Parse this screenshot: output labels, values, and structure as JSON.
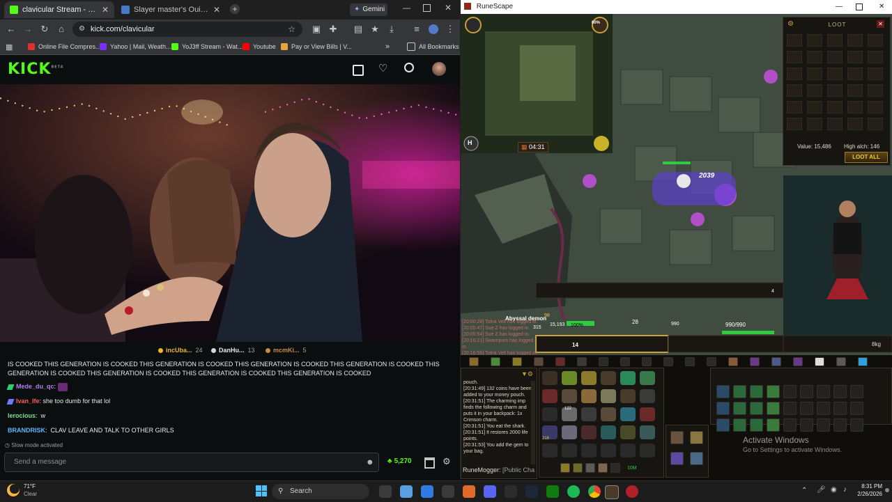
{
  "browser": {
    "tabs": [
      {
        "title": "clavicular Stream - Watch L",
        "active": true
      },
      {
        "title": "Slayer master's Ouija board - T",
        "active": false
      }
    ],
    "gemini_label": "Gemini",
    "url": "kick.com/clavicular",
    "bookmarks": [
      "Online File Compres...",
      "Yahoo | Mail, Weath...",
      "YoJ3ff Stream - Wat...",
      "Youtube",
      "Pay or View Bills | V...",
      "All Bookmarks"
    ],
    "bookmarks_more": "»"
  },
  "kick": {
    "logo_text": "KICK",
    "logo_badge": "BETA",
    "leaderboard": [
      {
        "name": "incUba...",
        "count": "24",
        "color": "#f0b429"
      },
      {
        "name": "DanHu...",
        "count": "13",
        "color": "#d9d9d9"
      },
      {
        "name": "mcmKi...",
        "count": "5",
        "color": "#c98a4b"
      }
    ],
    "chat": {
      "spam": "IS COOKED THIS GENERATION IS COOKED THIS GENERATION IS COOKED THIS GENERATION IS COOKED THIS GENERATION IS COOKED THIS GENERATION IS COOKED THIS GENERATION IS COOKED THIS GENERATION IS COOKED THIS GENERATION IS COOKED",
      "messages": [
        {
          "user": "Mede_du_qc",
          "text": "",
          "color": "#b37cf2",
          "badge": "#2ecc71"
        },
        {
          "user": "Ivan_Ife",
          "text": "she too dumb for that lol",
          "color": "#ff5a5a",
          "badge": "#6a7cff"
        },
        {
          "user": "lerocious",
          "text": "w",
          "color": "#7be08b",
          "badge": ""
        },
        {
          "user": "BRANDRISK",
          "text": "CLAV LEAVE AND TALK TO OTHER GIRLS",
          "color": "#5ab8ff",
          "badge": ""
        }
      ],
      "slow_mode": "Slow mode activated",
      "placeholder": "Send a message",
      "points": "5,270"
    }
  },
  "runescape": {
    "window_title": "RuneScape",
    "hud": {
      "timer": "04:31",
      "prayer_pct": "60%",
      "damage_splat": "2039",
      "target_name": "Abyssal demon",
      "target_hp": "15,193",
      "target_pct": "100%",
      "life_points": "990/990",
      "adrenaline": "98",
      "ability_bar_num": "28",
      "ability_bar_num2": "14",
      "xp_drop": "315",
      "xp_drop2": "990",
      "stack_count": "4",
      "ammo": "8kg"
    },
    "loot": {
      "title": "LOOT",
      "value_label": "Value: 15,486",
      "high_alch": "High alch: 146",
      "loot_all": "LOOT ALL"
    },
    "overlay_chat": [
      "[20:00:28] Tolna Vell has logged in.",
      "[20:05:47] Sue Z has logged in.",
      "[20:05:54] Sue Z has logged in.",
      "[20:16:21] Swampum has logged in.",
      "[20:16:56] Tolna Vell has logged in."
    ],
    "game_chat": [
      "pouch.",
      "[20:31:49] 132 coins have been added to your money pouch.",
      "[20:31:51] The charming imp finds the following charm and puts it in your backpack: 1x Crimson charm.",
      "[20:31:51] You eat the shark.",
      "[20:31:51] It restores 2000 life points.",
      "[20:31:53] You add the gem to your bag."
    ],
    "chat_input": "RuneMogger",
    "chat_channel": "[Public Cha",
    "inventory_counts": [
      "122",
      "216",
      "10M"
    ],
    "windows_watermark": {
      "title": "Activate Windows",
      "sub": "Go to Settings to activate Windows."
    }
  },
  "taskbar": {
    "weather_temp": "71°F",
    "weather_desc": "Clear",
    "search_placeholder": "Search",
    "time": "8:31 PM",
    "date": "2/26/2026"
  }
}
